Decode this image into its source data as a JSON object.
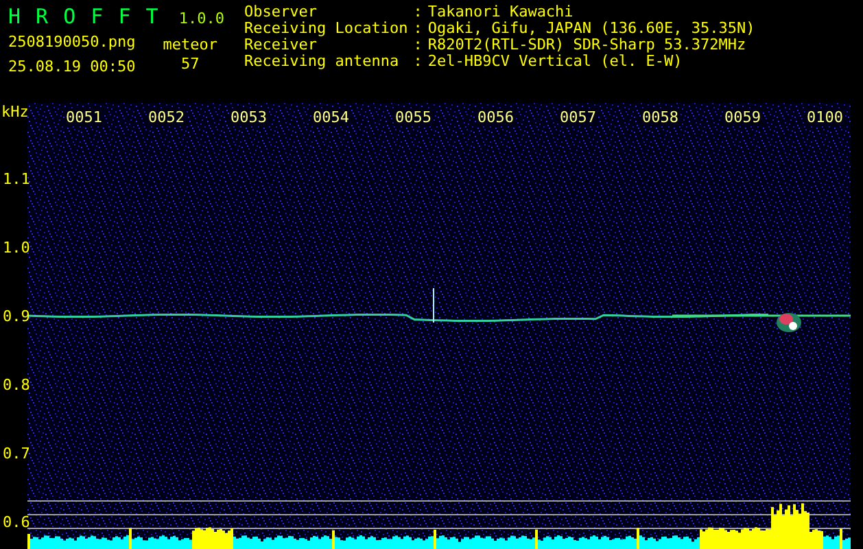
{
  "app": {
    "name": "H R O F F T",
    "version": "1.0.0"
  },
  "file": "2508190050.png",
  "datetime": "25.08.19 00:50",
  "meteor": {
    "label": "meteor",
    "count": "57"
  },
  "info": [
    {
      "label": "Observer",
      "separator": ":",
      "value": "Takanori Kawachi"
    },
    {
      "label": "Receiving Location",
      "separator": ":",
      "value": "Ogaki, Gifu, JAPAN (136.60E, 35.35N)"
    },
    {
      "label": "Receiver",
      "separator": ":",
      "value": "R820T2(RTL-SDR) SDR-Sharp 53.372MHz"
    },
    {
      "label": "Receiving antenna",
      "separator": ":",
      "value": "2el-HB9CV Vertical (el. E-W)"
    }
  ],
  "plot": {
    "unit": "kHz",
    "time_labels": [
      "0051",
      "0052",
      "0053",
      "0054",
      "0055",
      "0056",
      "0057",
      "0058",
      "0059",
      "0100"
    ],
    "freq_labels": [
      "1.1",
      "1.0",
      "0.9",
      "0.8",
      "0.7",
      "0.6"
    ]
  }
}
